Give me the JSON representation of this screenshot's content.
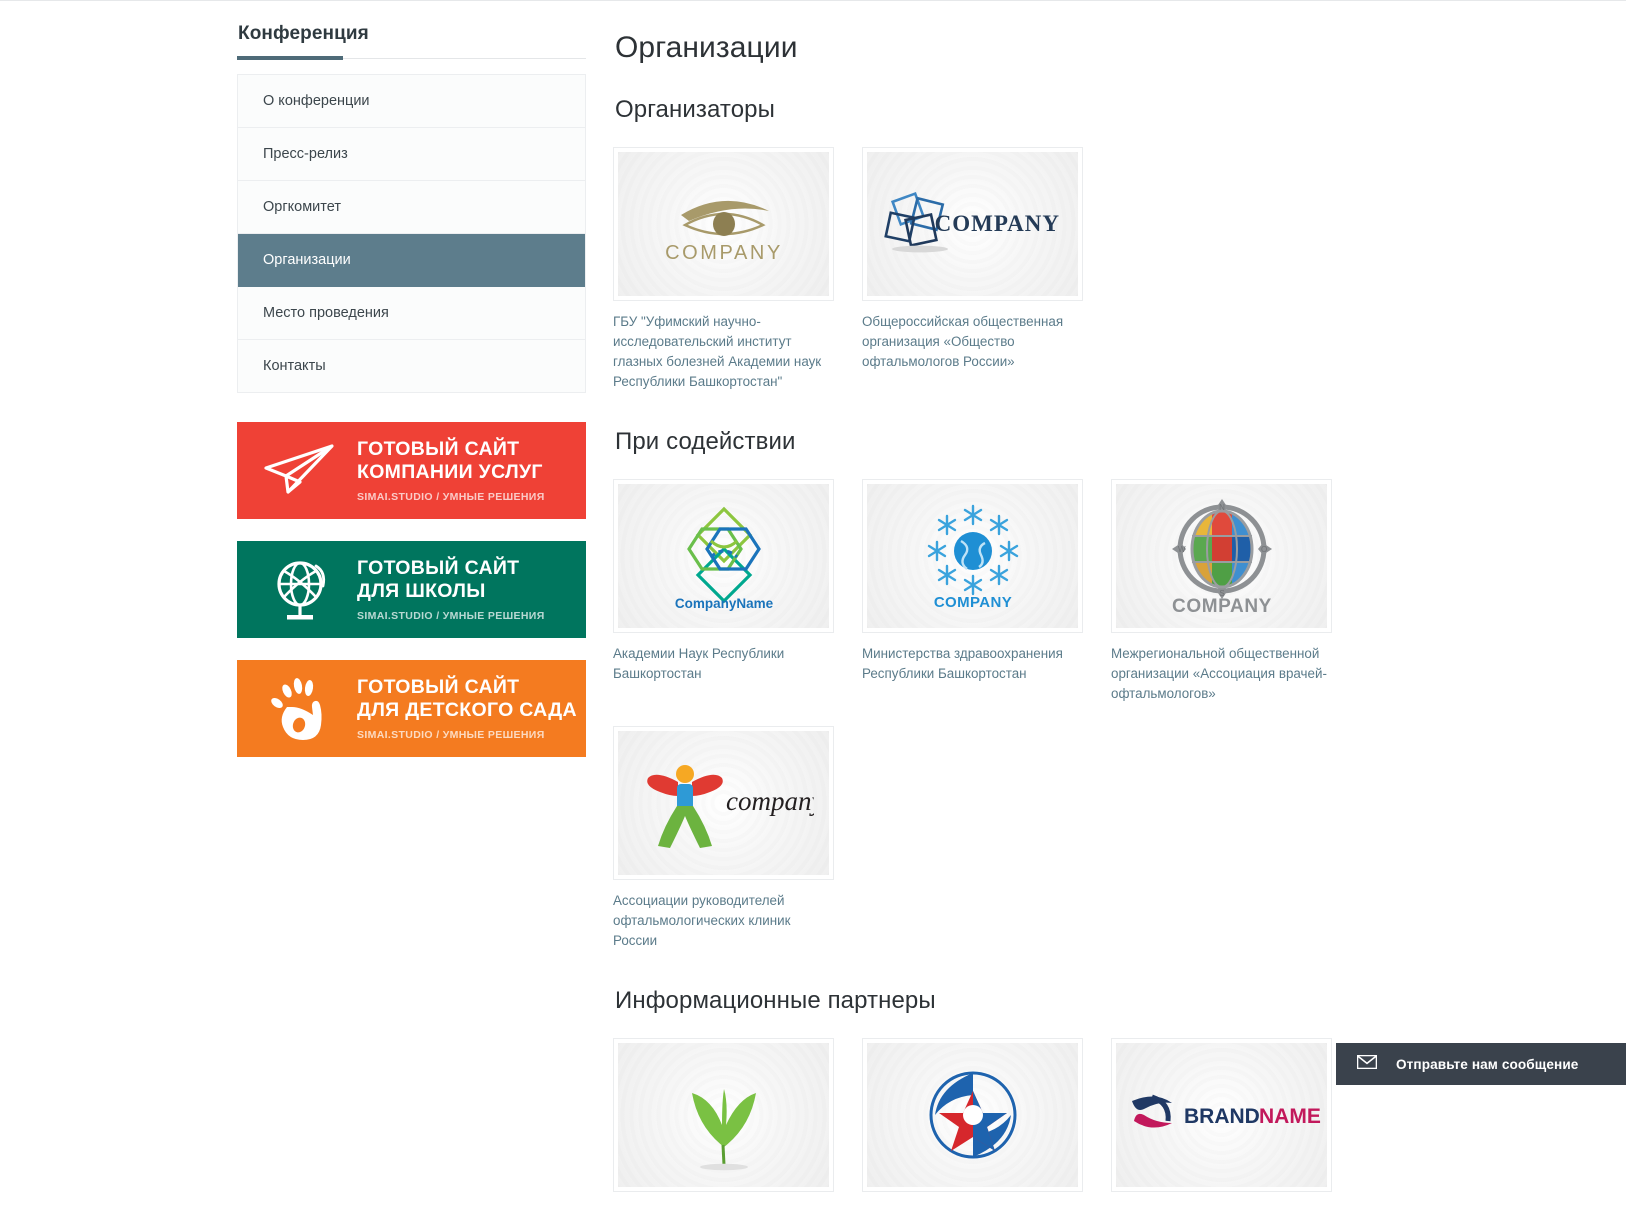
{
  "sidebar": {
    "title": "Конференция",
    "items": [
      {
        "label": "О конференции",
        "active": false
      },
      {
        "label": "Пресс-релиз",
        "active": false
      },
      {
        "label": "Оргкомитет",
        "active": false
      },
      {
        "label": "Организации",
        "active": true
      },
      {
        "label": "Место проведения",
        "active": false
      },
      {
        "label": "Контакты",
        "active": false
      }
    ],
    "banners": [
      {
        "line1": "ГОТОВЫЙ САЙТ",
        "line2": "КОМПАНИИ УСЛУГ",
        "subtitle": "SIMAI.STUDIO / УМНЫЕ РЕШЕНИЯ",
        "color": "#ef4136",
        "icon": "paper-plane-icon"
      },
      {
        "line1": "ГОТОВЫЙ САЙТ",
        "line2": "ДЛЯ ШКОЛЫ",
        "subtitle": "SIMAI.STUDIO / УМНЫЕ РЕШЕНИЯ",
        "color": "#00755e",
        "icon": "globe-icon"
      },
      {
        "line1": "ГОТОВЫЙ САЙТ",
        "line2": "ДЛЯ ДЕТСКОГО САДА",
        "subtitle": "SIMAI.STUDIO / УМНЫЕ РЕШЕНИЯ",
        "color": "#f47b20",
        "icon": "handprint-icon"
      }
    ]
  },
  "main": {
    "page_title": "Организации",
    "sections": [
      {
        "title": "Организаторы",
        "cards": [
          {
            "caption": "ГБУ \"Уфимский научно-исследовательский институт глазных болезней Академии наук Республики Башкортостан\"",
            "logo": "eye-company-logo",
            "logo_text": "COMPANY"
          },
          {
            "caption": "Общероссийская общественная организация «Общество офтальмологов России»",
            "logo": "cubes-company-logo",
            "logo_text": "COMPANY"
          }
        ]
      },
      {
        "title": "При содействии",
        "cards": [
          {
            "caption": "Академии Наук Республики Башкортостан",
            "logo": "interlocking-diamonds-logo",
            "logo_text": "CompanyName"
          },
          {
            "caption": "Министерства здравоохранения Республики Башкортостан",
            "logo": "globe-snowflake-logo",
            "logo_text": "COMPANY"
          },
          {
            "caption": "Межрегиональной общественной организации «Ассоциация врачей-офтальмологов»",
            "logo": "compass-globe-logo",
            "logo_text": "COMPANY"
          },
          {
            "caption": "Ассоциации руководителей офтальмологических клиник России",
            "logo": "person-company-logo",
            "logo_text": "company"
          }
        ]
      },
      {
        "title": "Информационные партнеры",
        "cards": [
          {
            "caption": "",
            "logo": "green-leaf-logo",
            "logo_text": ""
          },
          {
            "caption": "",
            "logo": "star-swirl-logo",
            "logo_text": ""
          },
          {
            "caption": "",
            "logo": "brandname-logo",
            "logo_text": "BRANDNAME"
          }
        ]
      }
    ]
  },
  "chat": {
    "label": "Отправьте нам сообщение",
    "icon": "envelope-icon"
  }
}
